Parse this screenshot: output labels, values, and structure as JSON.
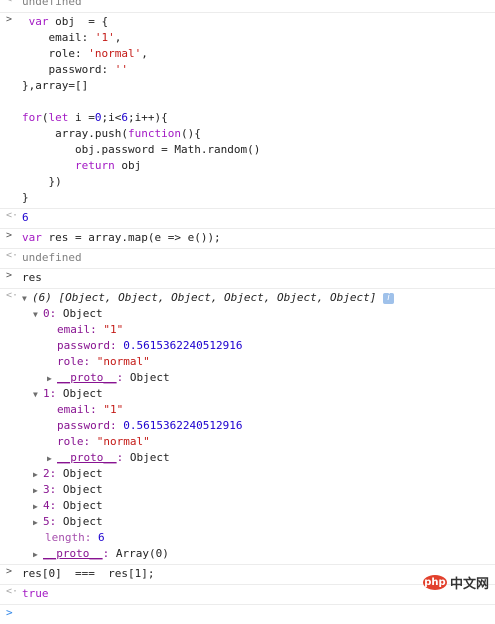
{
  "entries": {
    "top_undefined": "undefined",
    "code1": {
      "l1_kw": "var",
      "l1_rest": " obj  = {",
      "l2_key": "email: ",
      "l2_val": "'1'",
      "l2_end": ",",
      "l3_key": "role: ",
      "l3_val": "'normal'",
      "l3_end": ",",
      "l4_key": "password: ",
      "l4_val": "''",
      "l5": "},array=[]",
      "l7_kw": "for",
      "l7_a": "(",
      "l7_let": "let",
      "l7_b": " i =",
      "l7_zero": "0",
      "l7_c": ";i<",
      "l7_six": "6",
      "l7_d": ";i++){",
      "l8_a": "array.push(",
      "l8_fn": "function",
      "l8_b": "(){",
      "l9": "obj.password = Math.random()",
      "l10_kw": "return",
      "l10_rest": " obj",
      "l11": "})",
      "l12": "}"
    },
    "result1": "6",
    "code2_kw": "var",
    "code2_rest": " res = array.map(e => e());",
    "result2": "undefined",
    "code3": "res",
    "array_summary_len": "(6)",
    "array_summary_items": " [Object, Object, Object, Object, Object, Object]",
    "info_badge": "i",
    "item0": {
      "index": "0: ",
      "type": "Object",
      "email_key": "email: ",
      "email_val": "\"1\"",
      "password_key": "password: ",
      "password_val": "0.5615362240512916",
      "role_key": "role: ",
      "role_val": "\"normal\"",
      "proto_key": "__proto__",
      "proto_sep": ": ",
      "proto_val": "Object"
    },
    "item1": {
      "index": "1: ",
      "type": "Object",
      "email_key": "email: ",
      "email_val": "\"1\"",
      "password_key": "password: ",
      "password_val": "0.5615362240512916",
      "role_key": "role: ",
      "role_val": "\"normal\"",
      "proto_key": "__proto__",
      "proto_sep": ": ",
      "proto_val": "Object"
    },
    "collapsed_items": [
      {
        "index": "2: ",
        "type": "Object"
      },
      {
        "index": "3: ",
        "type": "Object"
      },
      {
        "index": "4: ",
        "type": "Object"
      },
      {
        "index": "5: ",
        "type": "Object"
      }
    ],
    "length_key": "length: ",
    "length_val": "6",
    "array_proto_key": "__proto__",
    "array_proto_sep": ": ",
    "array_proto_val": "Array(0)",
    "code4": "res[0]  ===  res[1];",
    "result4": "true"
  },
  "watermark": {
    "logo": "php",
    "text": "中文网"
  },
  "colors": {
    "keyword": "#a31ac4",
    "string": "#c41a16",
    "number": "#1c00cf",
    "property": "#881391",
    "prompt": "#368ae8"
  }
}
